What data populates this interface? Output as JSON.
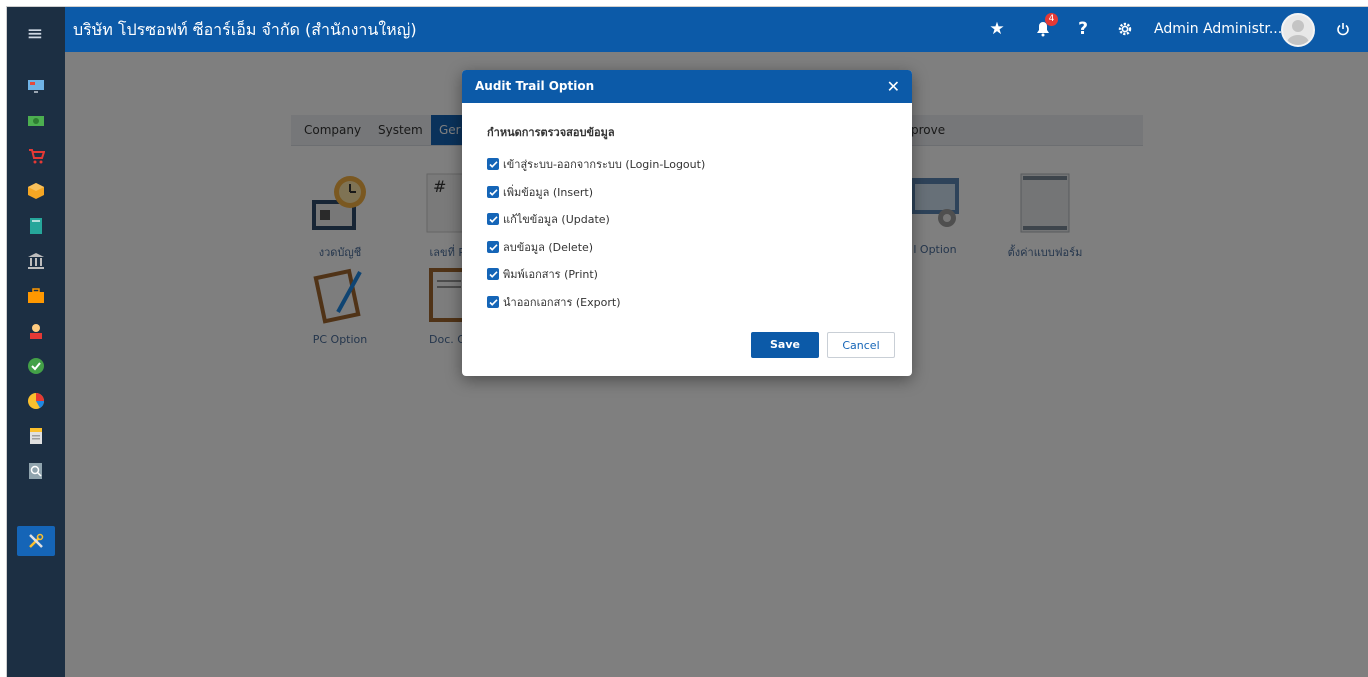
{
  "topbar": {
    "company_name": "บริษัท โปรซอฟท์ ซีอาร์เอ็ม จำกัด (สำนักงานใหญ่)",
    "notification_count": "4",
    "help_label": "?",
    "user_name": "Admin Administr..."
  },
  "tabs": [
    {
      "label": "Company"
    },
    {
      "label": "System"
    },
    {
      "label": "Ger"
    },
    {
      "label": "prove"
    }
  ],
  "tiles": [
    {
      "label": "งวดบัญชี"
    },
    {
      "label": "เลขที่ Ru"
    },
    {
      "label": "l Option"
    },
    {
      "label": "ตั้งค่าแบบฟอร์ม"
    },
    {
      "label": "PC Option"
    },
    {
      "label": "Doc. Op"
    }
  ],
  "modal": {
    "title": "Audit Trail Option",
    "section_title": "กำหนดการตรวจสอบข้อมูล",
    "options": [
      {
        "label": "เข้าสู่ระบบ-ออกจากระบบ (Login-Logout)",
        "checked": true
      },
      {
        "label": "เพิ่มข้อมูล (Insert)",
        "checked": true
      },
      {
        "label": "แก้ไขข้อมูล (Update)",
        "checked": true
      },
      {
        "label": "ลบข้อมูล (Delete)",
        "checked": true
      },
      {
        "label": "พิมพ์เอกสาร (Print)",
        "checked": true
      },
      {
        "label": "นำออกเอกสาร (Export)",
        "checked": true
      }
    ],
    "save_label": "Save",
    "cancel_label": "Cancel"
  },
  "colors": {
    "topbar": "#0c5aa8",
    "sidebar": "#1c2f43",
    "accent": "#1565b7"
  }
}
